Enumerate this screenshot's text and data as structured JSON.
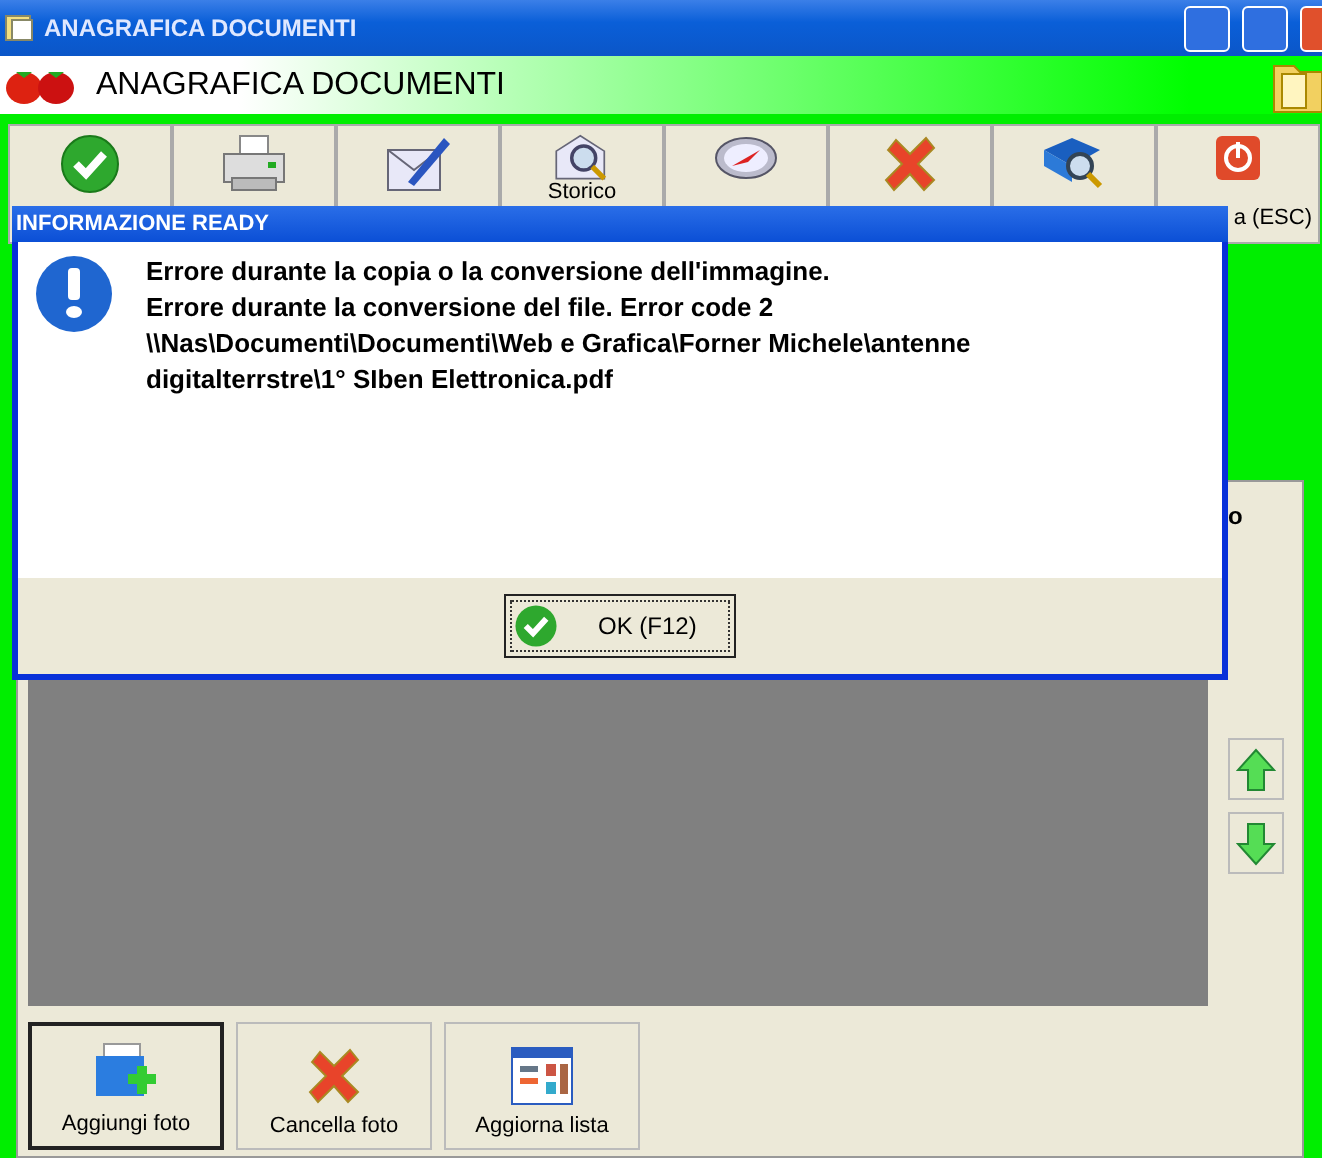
{
  "window": {
    "title": "ANAGRAFICA DOCUMENTI"
  },
  "header": {
    "title": "ANAGRAFICA DOCUMENTI"
  },
  "toolbar": [
    {
      "kind": "check"
    },
    {
      "kind": "printer"
    },
    {
      "kind": "mail-pen"
    },
    {
      "kind": "mail-search",
      "label": "Storico"
    },
    {
      "kind": "compass"
    },
    {
      "kind": "cross"
    },
    {
      "kind": "book-search"
    },
    {
      "kind": "power",
      "label": "a (ESC)"
    }
  ],
  "panel": {
    "column_label": "o",
    "photo_buttons": [
      {
        "kind": "add",
        "label": "Aggiungi foto",
        "selected": true
      },
      {
        "kind": "cross",
        "label": "Cancella foto",
        "selected": false
      },
      {
        "kind": "list",
        "label": "Aggiorna lista",
        "selected": false
      }
    ]
  },
  "dialog": {
    "title": "INFORMAZIONE READY",
    "message": [
      "Errore durante la copia o la conversione dell'immagine.",
      "Errore durante la conversione del file. Error code 2",
      "\\\\Nas\\Documenti\\Documenti\\Web e Grafica\\Forner Michele\\antenne",
      "digitalterrstre\\1° SIben Elettronica.pdf"
    ],
    "button": "OK (F12)"
  }
}
